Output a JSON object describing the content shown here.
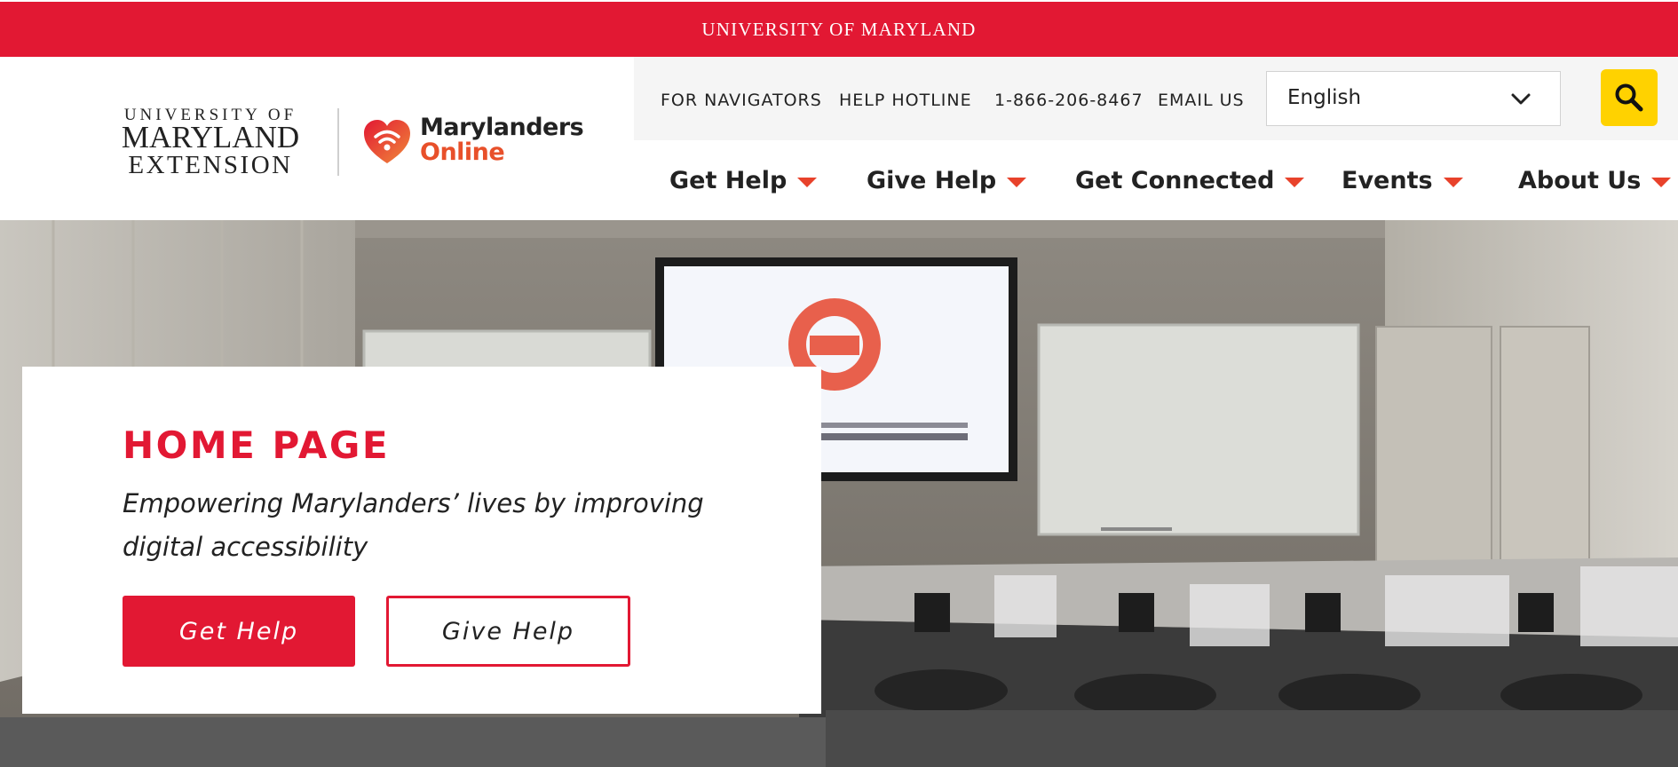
{
  "top_bar": {
    "title": "UNIVERSITY OF MARYLAND"
  },
  "logo": {
    "umd_line1": "UNIVERSITY OF",
    "umd_line2": "MARYLAND",
    "umd_line3": "EXTENSION",
    "mo_line1": "Marylanders",
    "mo_line2": "Online"
  },
  "utility_nav": {
    "links": [
      "FOR NAVIGATORS",
      "HELP HOTLINE",
      "1-866-206-8467",
      "EMAIL US"
    ],
    "language": "English"
  },
  "main_nav": {
    "items": [
      "Get Help",
      "Give Help",
      "Get Connected",
      "Events",
      "About Us"
    ]
  },
  "hero": {
    "title": "HOME PAGE",
    "tagline": "Empowering Marylanders’ lives by improving digital accessibility",
    "primary_button": "Get Help",
    "secondary_button": "Give Help"
  },
  "colors": {
    "brand_red": "#e21833",
    "accent_orange": "#e8422b",
    "search_yellow": "#ffd200"
  },
  "icons": [
    "chevron-down-icon",
    "search-icon",
    "caret-down-icon",
    "wifi-heart-icon"
  ]
}
